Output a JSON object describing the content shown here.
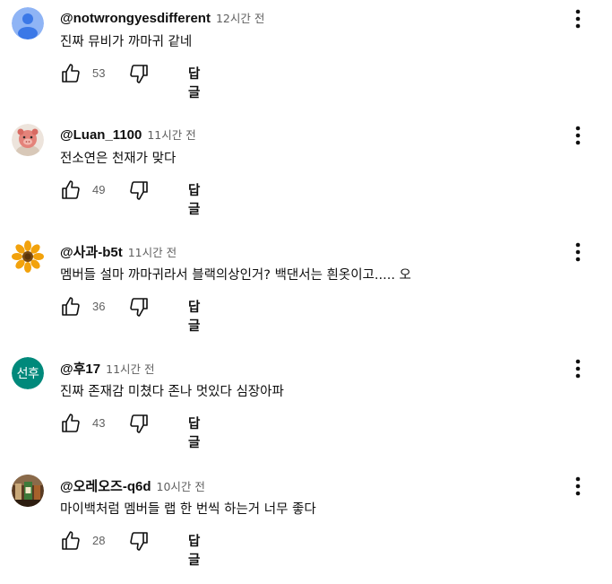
{
  "comments": [
    {
      "author": "@notwrongyesdifferent",
      "time": "12시간 전",
      "text": "진짜 뮤비가 까마귀 같네",
      "likes": "53",
      "reply_label": "답글",
      "avatar": {
        "type": "default-person-icon",
        "bg": "#8fb4f5",
        "fg": "#3b78e7"
      }
    },
    {
      "author": "@Luan_1100",
      "time": "11시간 전",
      "text": "전소연은 천재가 맞다",
      "likes": "49",
      "reply_label": "답글",
      "avatar": {
        "type": "cartoon-pig-image"
      }
    },
    {
      "author": "@사과-b5t",
      "time": "11시간 전",
      "text": "멤버들 설마 까마귀라서 블랙의상인거? 백댄서는 흰옷이고..... 오",
      "likes": "36",
      "reply_label": "답글",
      "avatar": {
        "type": "sunflower-image"
      }
    },
    {
      "author": "@후17",
      "time": "11시간 전",
      "text": "진짜 존재감 미쳤다 존나 멋있다 심장아파",
      "likes": "43",
      "reply_label": "답글",
      "avatar": {
        "type": "letters",
        "letters": "선후",
        "bg": "#00897b"
      }
    },
    {
      "author": "@오레오즈-q6d",
      "time": "10시간 전",
      "text": "마이백처럼 멤버들 랩 한 번씩 하는거 너무 좋다",
      "likes": "28",
      "reply_label": "답글",
      "avatar": {
        "type": "drink-photo-image"
      }
    }
  ],
  "icons": {
    "like": "thumb-up-icon",
    "dislike": "thumb-down-icon",
    "menu": "more-vert-icon"
  }
}
